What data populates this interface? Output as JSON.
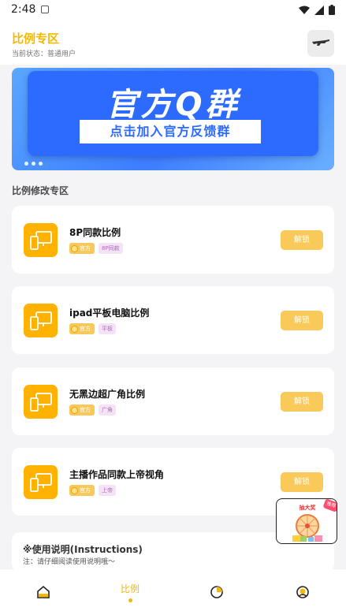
{
  "status_bar": {
    "time": "2:48"
  },
  "header": {
    "title": "比例专区",
    "status_label": "当前状态：普通用户"
  },
  "banner": {
    "title": "官方Q群",
    "cta": "点击加入官方反馈群"
  },
  "section": {
    "title": "比例修改专区"
  },
  "cards": [
    {
      "title": "8P同款比例",
      "tag_official": "官方",
      "tag_kind": "8P同款",
      "button": "解锁"
    },
    {
      "title": "ipad平板电脑比例",
      "tag_official": "官方",
      "tag_kind": "平板",
      "button": "解锁"
    },
    {
      "title": "无黑边超广角比例",
      "tag_official": "官方",
      "tag_kind": "广角",
      "button": "解锁"
    },
    {
      "title": "主播作品同款上帝视角",
      "tag_official": "官方",
      "tag_kind": "上帝",
      "button": "解锁"
    }
  ],
  "instructions": {
    "title": "※使用说明(Instructions)",
    "note": "注：请仔细阅读使用说明哦～"
  },
  "floating_ad": {
    "label": "抽大奖",
    "badge": "推荐"
  },
  "tabbar": {
    "items": [
      {
        "label": "",
        "icon": "home-icon"
      },
      {
        "label": "比例",
        "icon": "ratio-icon",
        "active": true
      },
      {
        "label": "",
        "icon": "chart-icon"
      },
      {
        "label": "",
        "icon": "profile-icon"
      }
    ]
  },
  "colors": {
    "accent": "#f5b800",
    "banner_blue": "#2d6bff",
    "button": "#f9c95a"
  }
}
